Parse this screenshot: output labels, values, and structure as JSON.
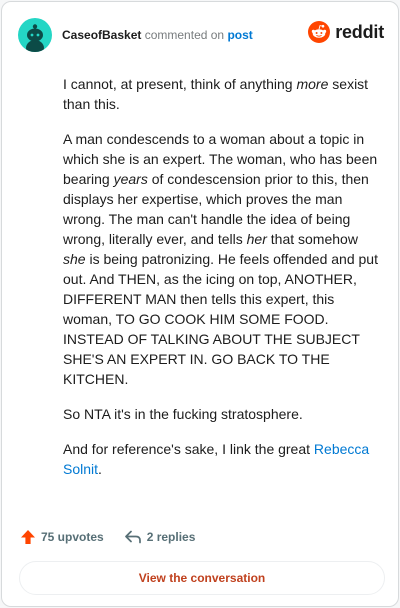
{
  "header": {
    "username": "CaseofBasket",
    "action_text": "commented on",
    "post_link": "post",
    "brand": "reddit"
  },
  "comment": {
    "p1_a": "I cannot, at present, think of anything ",
    "p1_em": "more",
    "p1_b": " sexist than this.",
    "p2_a": "A man condescends to a woman about a topic in which she is an expert. The woman, who has been bearing ",
    "p2_em1": "years",
    "p2_b": " of condescension prior to this, then displays her expertise, which proves the man wrong. The man can't handle the idea of being wrong, literally ever, and tells ",
    "p2_em2": "her",
    "p2_c": " that somehow ",
    "p2_em3": "she",
    "p2_d": " is being patronizing. He feels offended and put out. And THEN, as the icing on top, ANOTHER, DIFFERENT MAN then tells this expert, this woman, TO GO COOK HIM SOME FOOD. INSTEAD OF TALKING ABOUT THE SUBJECT SHE'S AN EXPERT IN. GO BACK TO THE KITCHEN.",
    "p3": "So NTA it's in the fucking stratosphere.",
    "p4_a": "And for reference's sake, I link the great ",
    "p4_link": "Rebecca Solnit",
    "p4_b": "."
  },
  "footer": {
    "upvotes": "75 upvotes",
    "replies": "2 replies",
    "view_button": "View the conversation"
  },
  "icons": {
    "avatar": "snoo-avatar-icon",
    "brand": "reddit-logo-icon",
    "upvote": "upvote-arrow-icon",
    "reply": "reply-arrow-icon"
  },
  "colors": {
    "accent_orange": "#ff4500",
    "link_blue": "#0079d3",
    "button_text": "#c0411e",
    "avatar_bg": "#24d6c5"
  }
}
